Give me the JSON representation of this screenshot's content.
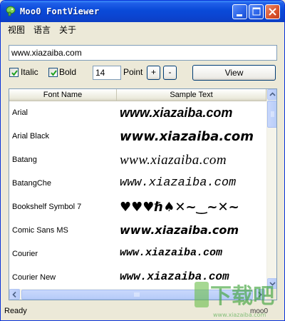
{
  "window": {
    "title": "Moo0 FontViewer"
  },
  "menu": [
    "视图",
    "语言",
    "关于"
  ],
  "url_field": {
    "value": "www.xiazaiba.com"
  },
  "options": {
    "italic_label": "Italic",
    "italic_checked": true,
    "bold_label": "Bold",
    "bold_checked": true,
    "point_value": "14",
    "point_label": "Point",
    "plus_label": "+",
    "minus_label": "-",
    "view_label": "View"
  },
  "list": {
    "columns": [
      "Font Name",
      "Sample Text"
    ],
    "rows": [
      {
        "name": "Arial",
        "sample": "www.xiazaiba.com"
      },
      {
        "name": "Arial Black",
        "sample": "www.xiazaiba.com"
      },
      {
        "name": "Batang",
        "sample": "www.xiazaiba.com"
      },
      {
        "name": "BatangChe",
        "sample": "www.xiazaiba.com"
      },
      {
        "name": "Bookshelf Symbol 7",
        "sample": "♥♥♥ℏ♠✕~‿~✕~"
      },
      {
        "name": "Comic Sans MS",
        "sample": "www.xiazaiba.com"
      },
      {
        "name": "Courier",
        "sample": "www.xiazaiba.com"
      },
      {
        "name": "Courier New",
        "sample": "www.xiazaiba.com"
      }
    ]
  },
  "status": {
    "text": "Ready",
    "right": "moo0"
  },
  "watermark": {
    "text": "下载吧",
    "sub": "www.xiazaiba.com"
  },
  "colors": {
    "titlebar": "#0A4AD8",
    "window_bg": "#ECE9D8",
    "close_button": "#D9532D"
  }
}
